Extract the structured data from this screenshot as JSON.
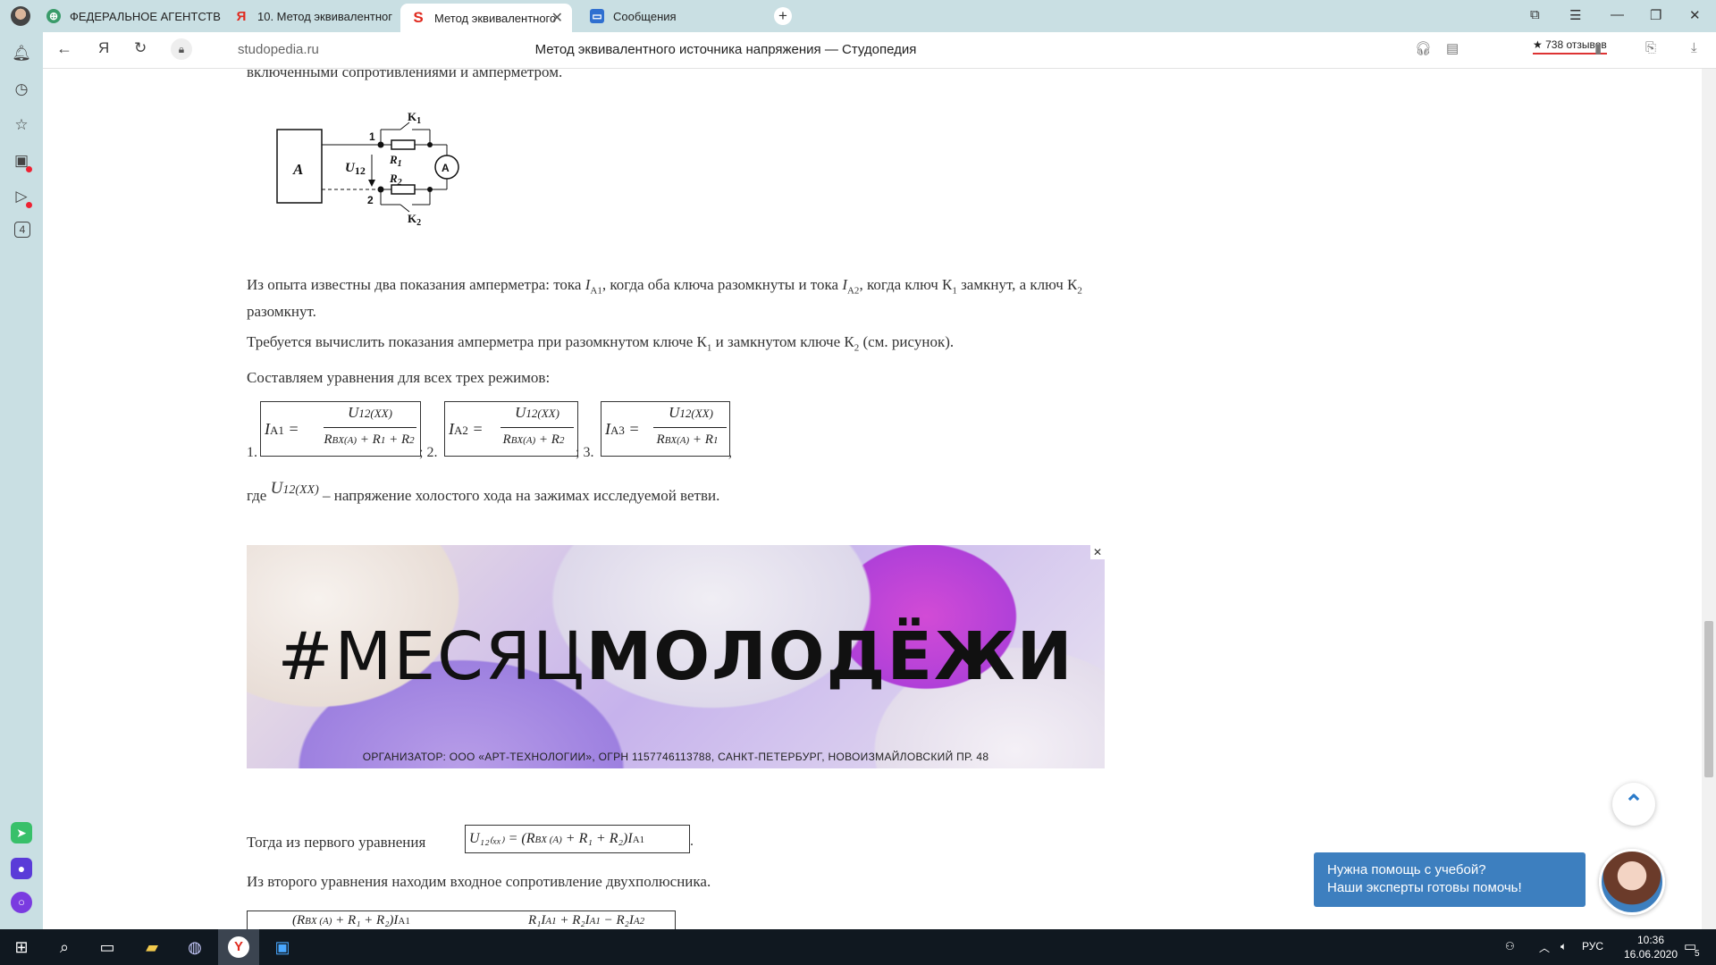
{
  "tabs": [
    {
      "label": "ФЕДЕРАЛЬНОЕ АГЕНТСТВ",
      "icon": "globe-icon"
    },
    {
      "label": "10. Метод эквивалентног",
      "icon": "yandex-icon"
    },
    {
      "label": "Метод эквивалентного",
      "icon": "studopedia-icon"
    },
    {
      "label": "Сообщения",
      "icon": "messages-icon"
    }
  ],
  "addressbar": {
    "domain": "studopedia.ru",
    "title": "Метод эквивалентного источника напряжения — Студопедия",
    "reviews": "★ 738 отзывов",
    "ya": "Я"
  },
  "article": {
    "intro_tail": "включенными сопротивлениями и амперметром.",
    "circuit": {
      "block": "A",
      "voltage": "U",
      "voltage_sub": "12",
      "node1": "1",
      "node2": "2",
      "k1": "K",
      "k1_sub": "1",
      "k2": "K",
      "k2_sub": "2",
      "r1": "R",
      "r1_sub": "1",
      "r2": "R",
      "r2_sub": "2",
      "ammeter": "A"
    },
    "p1_a": "Из опыта известны два показания амперметра: тока ",
    "p1_i": "I",
    "p1_s1": "A1",
    "p1_b": ", когда оба ключа разомкнуты и тока ",
    "p1_s2": "A2",
    "p1_c": ", когда ключ К",
    "p1_s3": "1",
    "p1_d": " замкнут, а ключ К",
    "p1_s4": "2",
    "p1_e": " разомкнут.",
    "p2_a": "Требуется вычислить показания амперметра при разомкнутом ключе К",
    "p2_s1": "1",
    "p2_b": " и замкнутом ключе К",
    "p2_s2": "2",
    "p2_c": " (см. рисунок).",
    "p3": "Составляем уравнения для всех трех режимов:",
    "eq_nums": [
      "1.",
      "; 2.",
      "; 3.",
      ","
    ],
    "eq": [
      {
        "lhs": "I",
        "lhs_sub": "A1",
        "num": "U",
        "num_sub": "12(XX)",
        "den": "R",
        "den_sub": "BX(A)",
        "den_tail": " + R",
        "t1": "1",
        "t2": " + R",
        "t3": "2"
      },
      {
        "lhs": "I",
        "lhs_sub": "A2",
        "num": "U",
        "num_sub": "12(XX)",
        "den": "R",
        "den_sub": "BX(A)",
        "den_tail": " + R",
        "t1": "2",
        "t2": "",
        "t3": ""
      },
      {
        "lhs": "I",
        "lhs_sub": "A3",
        "num": "U",
        "num_sub": "12(XX)",
        "den": "R",
        "den_sub": "BX(A)",
        "den_tail": " + R",
        "t1": "1",
        "t2": "",
        "t3": ""
      }
    ],
    "where_a": "где ",
    "where_u": "U",
    "where_sub": "12(XX)",
    "where_b": " – напряжение холостого хода на зажимах исследуемой ветви.",
    "then_text": "Тогда из первого уравнения ",
    "then_formula": "U₁₂₍ₓₓ₎ = (R",
    "then_formula_sub": "BX (A)",
    "then_formula_tail": " + R₁ + R₂)I",
    "then_formula_i": "A1",
    "from_second": "Из второго уравнения находим входное сопротивление двухполюсника.",
    "bottom_formula_left": "(R",
    "bottom_formula_left_sub": "BX (A)",
    "bottom_formula_left_tail": " + R₁ + R₂)I",
    "bottom_formula_left_i": "A1",
    "bottom_formula_right": "R₁I",
    "bottom_formula_right_sub": "A1",
    "bottom_formula_right_tail": " + R₂I",
    "bottom_formula_right_sub2": "A1",
    "bottom_formula_right_tail2": " − R₂I",
    "bottom_formula_right_sub3": "A2"
  },
  "ad": {
    "hash_thin": "#МЕСЯЦ",
    "hash_bold": "МОЛОДЁЖИ",
    "organizer": "ОРГАНИЗАТОР: ООО «АРТ-ТЕХНОЛОГИИ», ОГРН 1157746113788, САНКТ-ПЕТЕРБУРГ, НОВОИЗМАЙЛОВСКИЙ ПР. 48",
    "close": "✕"
  },
  "chat": {
    "line1": "Нужна помощь с учебой?",
    "line2": "Наши эксперты готовы помочь!"
  },
  "sidebar_badge": "4",
  "taskbar": {
    "lang": "РУС",
    "time": "10:36",
    "date": "16.06.2020",
    "notif_count": "5"
  },
  "colors": {
    "tabbar": "#c9dfe3",
    "accent": "#3d7fbf",
    "taskbar": "#101820"
  }
}
